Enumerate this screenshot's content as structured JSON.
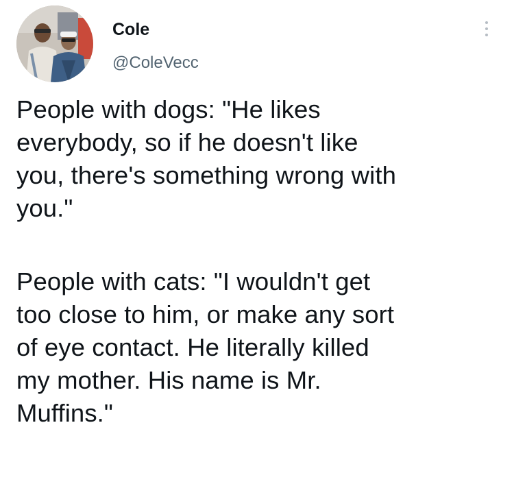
{
  "author": {
    "display_name": "Cole",
    "handle": "@ColeVecc",
    "avatar_icon": "profile-photo"
  },
  "menu": {
    "icon": "more-options-icon"
  },
  "tweet": {
    "paragraph1_lines": [
      "People with dogs: \"He likes",
      "everybody, so if he doesn't like",
      "you, there's something wrong with",
      "you.\""
    ],
    "paragraph2_lines": [
      "People with cats: \"I wouldn't get",
      "too close to him, or make any sort",
      "of eye contact. He literally killed",
      "my mother. His name is Mr.",
      "Muffins.\""
    ]
  },
  "colors": {
    "text": "#0f1419",
    "secondary_text": "#536471",
    "background": "#ffffff"
  }
}
